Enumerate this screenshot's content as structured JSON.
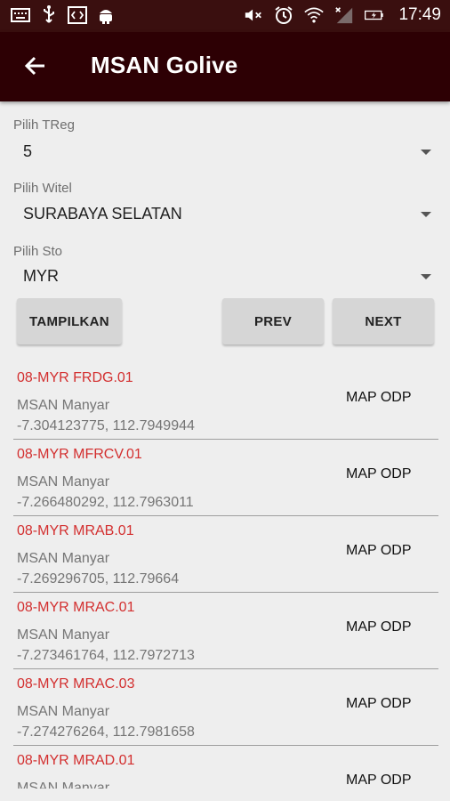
{
  "status_bar": {
    "time": "17:49",
    "icons": [
      "keyboard-icon",
      "usb-icon",
      "code-icon",
      "android-icon",
      "mute-icon",
      "alarm-icon",
      "wifi-icon",
      "signal-icon",
      "battery-icon"
    ]
  },
  "app_bar": {
    "title": "MSAN Golive"
  },
  "filters": {
    "treg_label": "Pilih TReg",
    "treg_value": "5",
    "witel_label": "Pilih Witel",
    "witel_value": "SURABAYA SELATAN",
    "sto_label": "Pilih Sto",
    "sto_value": "MYR"
  },
  "buttons": {
    "show": "TAMPILKAN",
    "prev": "PREV",
    "next": "NEXT"
  },
  "items": [
    {
      "code": "08-MYR FRDG.01",
      "name": "MSAN Manyar",
      "coords": "-7.304123775, 112.7949944",
      "action": "MAP ODP"
    },
    {
      "code": "08-MYR MFRCV.01",
      "name": "MSAN Manyar",
      "coords": "-7.266480292, 112.7963011",
      "action": "MAP ODP"
    },
    {
      "code": "08-MYR MRAB.01",
      "name": "MSAN Manyar",
      "coords": "-7.269296705, 112.79664",
      "action": "MAP ODP"
    },
    {
      "code": "08-MYR MRAC.01",
      "name": "MSAN Manyar",
      "coords": "-7.273461764, 112.7972713",
      "action": "MAP ODP"
    },
    {
      "code": "08-MYR MRAC.03",
      "name": "MSAN Manyar",
      "coords": "-7.274276264, 112.7981658",
      "action": "MAP ODP"
    },
    {
      "code": "08-MYR MRAD.01",
      "name": "MSAN Manyar",
      "coords": "",
      "action": "MAP ODP"
    }
  ],
  "colors": {
    "primary": "#2d0004",
    "status": "#3a0f0f",
    "accent_text": "#d32f2f"
  }
}
